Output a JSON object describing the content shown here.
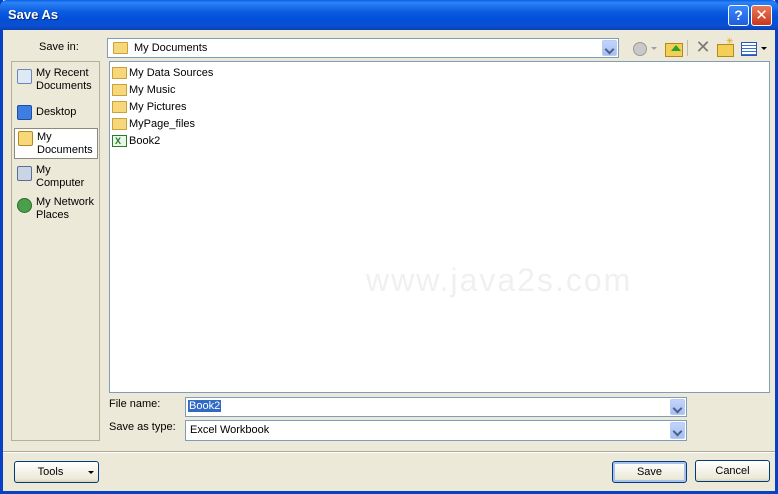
{
  "window": {
    "title": "Save As",
    "help_label": "?",
    "close_label": "✕"
  },
  "save_in": {
    "label": "Save in:",
    "value": "My Documents"
  },
  "toolbar": {
    "back": "back-icon",
    "up_folder": "up-folder-icon",
    "delete_label": "✕",
    "new_folder": "new-folder-icon",
    "views": "views-icon"
  },
  "places": [
    {
      "label_line1": "My Recent",
      "label_line2": "Documents",
      "icon": "recent-documents-icon"
    },
    {
      "label_line1": "Desktop",
      "label_line2": "",
      "icon": "desktop-icon"
    },
    {
      "label_line1": "My",
      "label_line2": "Documents",
      "icon": "my-documents-icon",
      "selected": true
    },
    {
      "label_line1": "My",
      "label_line2": "Computer",
      "icon": "my-computer-icon"
    },
    {
      "label_line1": "My Network",
      "label_line2": "Places",
      "icon": "network-places-icon"
    }
  ],
  "files": [
    {
      "name": "My Data Sources",
      "icon": "folder-icon"
    },
    {
      "name": "My Music",
      "icon": "folder-icon"
    },
    {
      "name": "My Pictures",
      "icon": "folder-icon"
    },
    {
      "name": "MyPage_files",
      "icon": "folder-icon"
    },
    {
      "name": "Book2",
      "icon": "excel-file-icon"
    }
  ],
  "watermark": "www.java2s.com",
  "file_name": {
    "label": "File name:",
    "value": "Book2"
  },
  "save_as_type": {
    "label": "Save as type:",
    "value": "Excel Workbook"
  },
  "buttons": {
    "tools": "Tools",
    "save": "Save",
    "cancel": "Cancel"
  },
  "colors": {
    "title_bar": "#0a5fe4",
    "selection": "#316ac5",
    "dialog_bg": "#ece9d8"
  }
}
